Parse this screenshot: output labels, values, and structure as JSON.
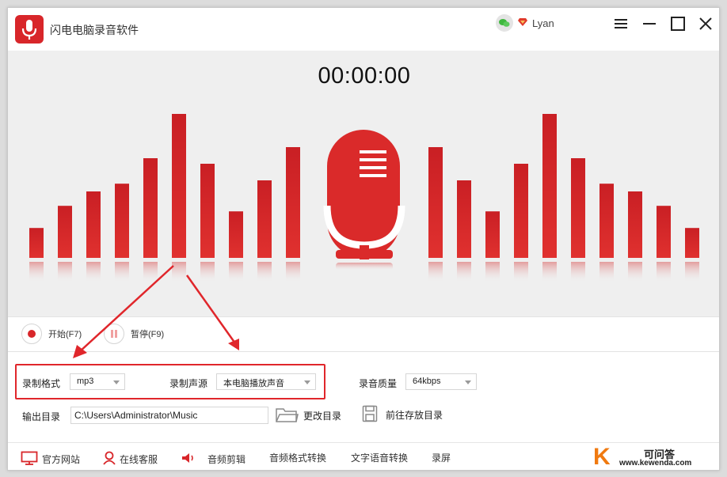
{
  "app": {
    "title": "闪电电脑录音软件",
    "user_name": "Lyan",
    "accent_color": "#d8262a",
    "logo_icon": "microphone-icon"
  },
  "window_controls": [
    "menu-icon",
    "minimize-icon",
    "maximize-icon",
    "close-icon"
  ],
  "recorder": {
    "timer": "00:00:00",
    "start_label": "开始(F7)",
    "pause_label": "暂停(F9)",
    "level_bar_heights": [
      0.27,
      0.47,
      0.6,
      0.67,
      0.9,
      1.3,
      0.85,
      0.42,
      0.7,
      1.0
    ]
  },
  "settings": {
    "format_label": "录制格式",
    "format_value": "mp3",
    "source_label": "录制声源",
    "source_value": "本电脑播放声音",
    "quality_label": "录音质量",
    "quality_value": "64kbps",
    "output_label": "输出目录",
    "output_path": "C:\\Users\\Administrator\\Music",
    "change_dir_label": "更改目录",
    "open_dir_label": "前往存放目录"
  },
  "footer": {
    "website": "官方网站",
    "support": "在线客服",
    "audio_edit": "音频剪辑",
    "format_convert": "音频格式转换",
    "tts": "文字语音转换",
    "screen_record": "录屏"
  },
  "watermark": {
    "letter": "K",
    "name": "可问答",
    "url": "www.kewenda.com"
  }
}
